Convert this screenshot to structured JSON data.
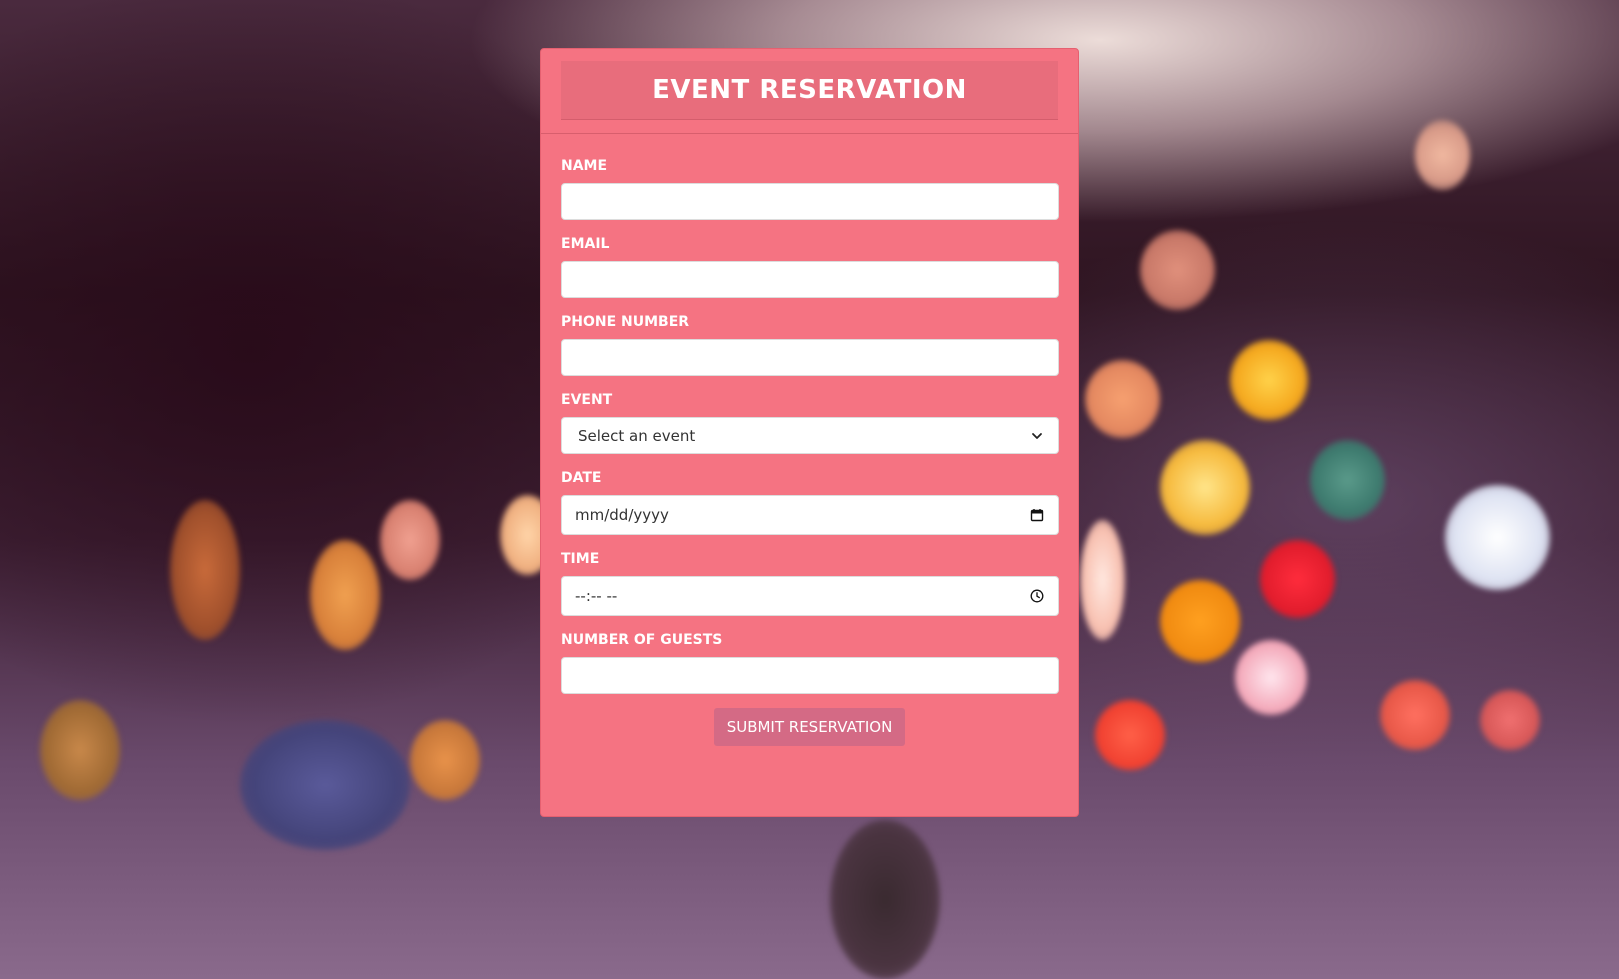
{
  "page": {
    "title": "EVENT RESERVATION"
  },
  "form": {
    "fields": {
      "name": {
        "label": "NAME",
        "value": ""
      },
      "email": {
        "label": "EMAIL",
        "value": ""
      },
      "phone": {
        "label": "PHONE NUMBER",
        "value": ""
      },
      "event": {
        "label": "EVENT",
        "selected": "Select an event"
      },
      "date": {
        "label": "DATE",
        "placeholder": "mm/dd/yyyy"
      },
      "time": {
        "label": "TIME",
        "placeholder": "--:-- --"
      },
      "guests": {
        "label": "NUMBER OF GUESTS",
        "value": ""
      }
    },
    "submit_label": "SUBMIT RESERVATION"
  },
  "icons": {
    "event_select": "chevron-down-icon",
    "date_picker": "calendar-icon",
    "time_picker": "clock-icon"
  },
  "colors": {
    "card": "#f57382",
    "header": "#e86d7c",
    "submit": "#d46a85",
    "text": "#ffffff"
  }
}
